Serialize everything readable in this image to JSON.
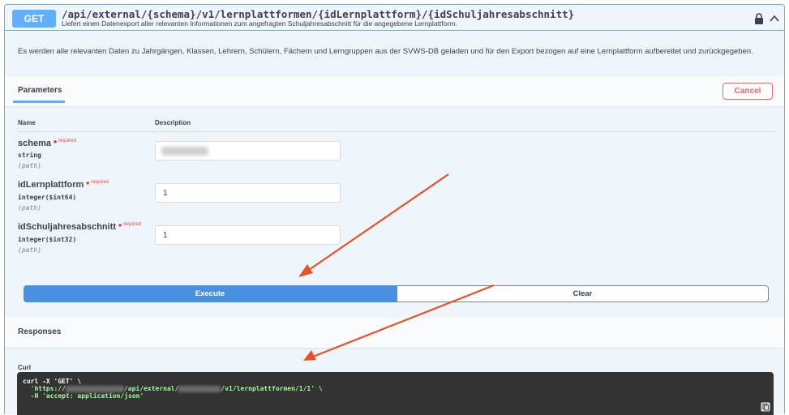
{
  "operation": {
    "method": "GET",
    "path": "/api/external/{schema}/v1/lernplattformen/{idLernplattform}/{idSchuljahresabschnitt}",
    "summary": "Liefert einen Datenexport aller relevanten Informationen zum angefragten Schuljahresabschnitt für die angegebene Lernplattform.",
    "description": "Es werden alle relevanten Daten zu Jahrgängen, Klassen, Lehrern, Schülern, Fächern und Lerngruppen aus der SVWS-DB geladen und für den Export bezogen auf eine Lernplattform aufbereitet und zurückgegeben."
  },
  "parameters_section": {
    "tab_label": "Parameters",
    "cancel_label": "Cancel",
    "col_name": "Name",
    "col_description": "Description",
    "required_star": "*",
    "required_text": "required",
    "params": [
      {
        "name": "schema",
        "type": "string",
        "in": "(path)",
        "value": ""
      },
      {
        "name": "idLernplattform",
        "type": "integer($int64)",
        "in": "(path)",
        "value": "1"
      },
      {
        "name": "idSchuljahresabschnitt",
        "type": "integer($int32)",
        "in": "(path)",
        "value": "1"
      }
    ]
  },
  "actions": {
    "execute_label": "Execute",
    "clear_label": "Clear"
  },
  "responses": {
    "title": "Responses",
    "curl_label": "Curl",
    "curl_line1": "curl -X 'GET' \\",
    "curl_line2_prefix": "  'https://",
    "curl_line2_mid": "/api/external/",
    "curl_line2_suffix": "/v1/lernplattformen/1/1' \\",
    "curl_line3": "  -H 'accept: application/json'"
  },
  "colors": {
    "get_blue": "#61affe",
    "execute_blue": "#4990e2",
    "cancel_red": "#ff6060",
    "annotation_arrow": "#e8502a"
  },
  "icons": [
    "lock-icon",
    "chevron-up-icon",
    "copy-icon"
  ]
}
